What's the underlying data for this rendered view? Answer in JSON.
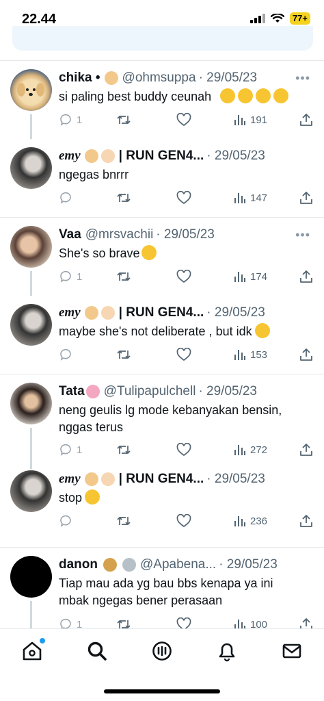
{
  "status_bar": {
    "time": "22.44",
    "battery": "77+"
  },
  "replies": [
    {
      "name": "chika •",
      "handle": "@ohmsuppa",
      "date": "· 29/05/23",
      "text": "si paling best buddy ceunah",
      "emoji": "mindblown",
      "emoji_count": 4,
      "views": "191",
      "replies": "1",
      "avatar": "golden-retriever-avatar"
    },
    {
      "name": "emy",
      "handle": "| RUN GEN4...",
      "date": "· 29/05/23",
      "text": "ngegas bnrrr",
      "views": "147",
      "avatar": "person-avatar"
    },
    {
      "name": "Vaa",
      "handle": "@mrsvachii",
      "date": "· 29/05/23",
      "text": "She's so brave",
      "emoji": "grimace",
      "views": "174",
      "replies": "1",
      "avatar": "person-avatar"
    },
    {
      "name": "emy",
      "handle": "| RUN GEN4...",
      "date": "· 29/05/23",
      "text": "maybe she's not deliberate , but idk",
      "emoji": "rofl",
      "views": "153",
      "avatar": "person-avatar"
    },
    {
      "name": "Tata",
      "handle": "@Tulipapulchell",
      "date": "· 29/05/23",
      "text": "neng geulis lg mode kebanyakan bensin, nggas terus",
      "views": "272",
      "replies": "1",
      "avatar": "person-avatar"
    },
    {
      "name": "emy",
      "handle": "| RUN GEN4...",
      "date": "· 29/05/23",
      "text": "stop",
      "emoji": "crying",
      "views": "236",
      "avatar": "person-avatar"
    },
    {
      "name": "danon",
      "handle": "@Apabena...",
      "date": "· 29/05/23",
      "text": "Tiap mau ada yg bau bbs kenapa ya ini mbak ngegas bener perasaan",
      "views": "100",
      "replies": "1",
      "avatar": "black-circle-avatar"
    }
  ],
  "colors": {
    "accent": "#1d9bf0",
    "muted": "#536471",
    "divider": "#e4e8eb"
  },
  "nav": [
    "home-icon",
    "search-icon",
    "communities-icon",
    "notifications-icon",
    "messages-icon"
  ]
}
